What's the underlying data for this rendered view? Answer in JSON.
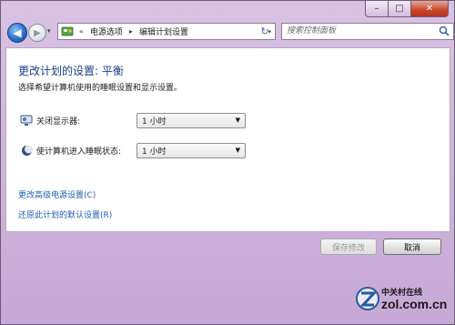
{
  "window": {
    "caption": {
      "minimize": "–",
      "maximize": "□",
      "close": "✕"
    }
  },
  "nav": {
    "back_icon": "back-arrow-icon",
    "forward_icon": "forward-arrow-icon",
    "recent_dropdown": "▾",
    "address": {
      "overflow": "«",
      "segments": [
        "电源选项",
        "编辑计划设置"
      ],
      "separator": "▸",
      "dropdown": "▾"
    },
    "refresh": "↻",
    "search_placeholder": "搜索控制面板"
  },
  "content": {
    "title": "更改计划的设置: 平衡",
    "subtitle": "选择希望计算机使用的睡眠设置和显示设置。",
    "settings": [
      {
        "label": "关闭显示器:",
        "value": "1 小时",
        "icon": "monitor-icon"
      },
      {
        "label": "使计算机进入睡眠状态:",
        "value": "1 小时",
        "icon": "moon-icon"
      }
    ],
    "links": [
      "更改高级电源设置(C)",
      "还原此计划的默认设置(R)"
    ]
  },
  "buttons": {
    "save": "保存修改",
    "cancel": "取消"
  },
  "watermark": {
    "name": "中关村在线",
    "site": "zol.com.cn"
  }
}
